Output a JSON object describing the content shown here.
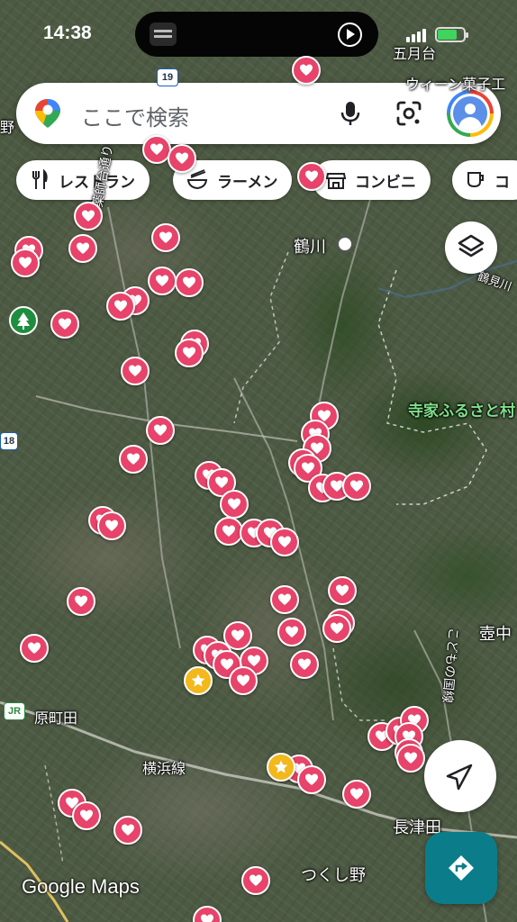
{
  "status_bar": {
    "time": "14:38"
  },
  "search": {
    "placeholder": "ここで検索"
  },
  "chips": [
    {
      "label": "レストラン",
      "icon": "fork-knife-icon"
    },
    {
      "label": "ラーメン",
      "icon": "ramen-bowl-icon"
    },
    {
      "label": "コンビニ",
      "icon": "convenience-store-icon"
    },
    {
      "label": "コ",
      "icon": "coffee-cup-icon"
    }
  ],
  "map_labels": {
    "satsukigaoka": "五月台",
    "wien_kashi": "ウィーン菓子工",
    "tsurukawa": "鶴川",
    "yakushidai": "薬師台通り",
    "terakata_park": "寺家ふるさと村",
    "harumachida": "原町田",
    "yokohama_line": "横浜線",
    "nagatsuta": "長津田",
    "tsukushino": "つくし野",
    "tsubonaka": "壺中",
    "kodomo_kuni": "こどもの国線",
    "tsurumigawa": "鶴見川",
    "no_label": "野",
    "route_19": "19",
    "route_18": "18",
    "jr": "JR"
  },
  "brand": "Google Maps",
  "colors": {
    "heart_pin": "#e8436a",
    "star_pin": "#f2b81c",
    "directions": "#0b7d8a",
    "park": "#7fe08a"
  }
}
